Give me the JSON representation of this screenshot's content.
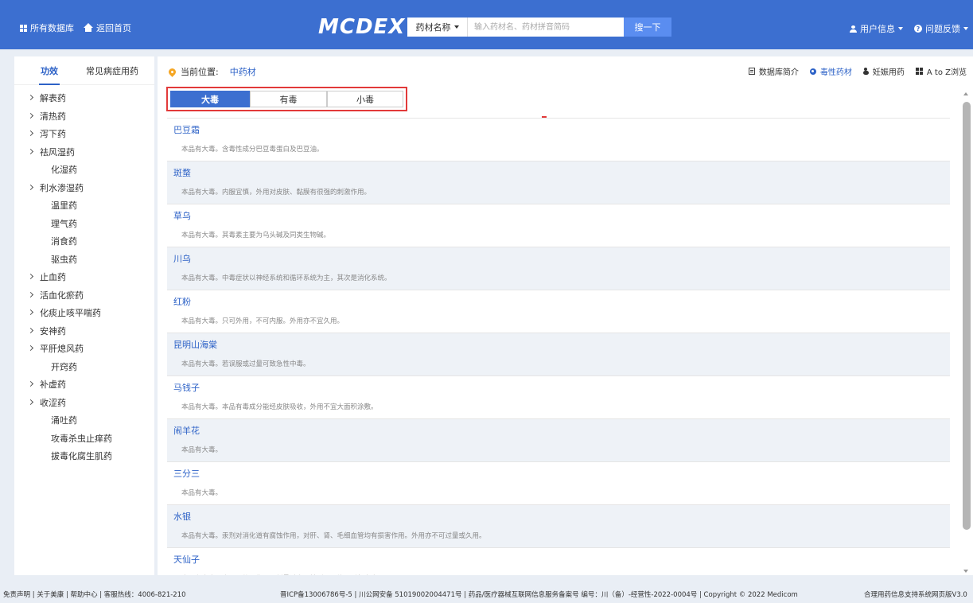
{
  "header": {
    "all_databases": "所有数据库",
    "back_home": "返回首页",
    "logo": "MCDEX",
    "search_type": "药材名称",
    "search_placeholder": "输入药材名、药材拼音简码",
    "search_button": "搜一下",
    "user_info": "用户信息",
    "feedback": "问题反馈"
  },
  "sidebar": {
    "tabs": [
      "功效",
      "常见病症用药"
    ],
    "items": [
      {
        "label": "解表药",
        "expandable": true
      },
      {
        "label": "清热药",
        "expandable": true
      },
      {
        "label": "泻下药",
        "expandable": true
      },
      {
        "label": "祛风湿药",
        "expandable": true
      },
      {
        "label": "化湿药",
        "expandable": false
      },
      {
        "label": "利水渗湿药",
        "expandable": true
      },
      {
        "label": "温里药",
        "expandable": false
      },
      {
        "label": "理气药",
        "expandable": false
      },
      {
        "label": "消食药",
        "expandable": false
      },
      {
        "label": "驱虫药",
        "expandable": false
      },
      {
        "label": "止血药",
        "expandable": true
      },
      {
        "label": "活血化瘀药",
        "expandable": true
      },
      {
        "label": "化痰止咳平喘药",
        "expandable": true
      },
      {
        "label": "安神药",
        "expandable": true
      },
      {
        "label": "平肝熄风药",
        "expandable": true
      },
      {
        "label": "开窍药",
        "expandable": false
      },
      {
        "label": "补虚药",
        "expandable": true
      },
      {
        "label": "收涩药",
        "expandable": true
      },
      {
        "label": "涌吐药",
        "expandable": false
      },
      {
        "label": "攻毒杀虫止痒药",
        "expandable": false
      },
      {
        "label": "拔毒化腐生肌药",
        "expandable": false
      }
    ]
  },
  "main": {
    "breadcrumb_label": "当前位置:",
    "breadcrumb_value": "中药材",
    "links": {
      "intro": "数据库简介",
      "toxic": "毒性药材",
      "pregnancy": "妊娠用药",
      "az": "A to Z浏览"
    },
    "tabs": [
      "大毒",
      "有毒",
      "小毒"
    ],
    "active_tab": 0,
    "rows": [
      {
        "name": "巴豆霜",
        "desc": "本品有大毒。含毒性成分巴豆毒蛋白及巴豆油。"
      },
      {
        "name": "斑蝥",
        "desc": "本品有大毒。内服宜慎，外用对皮肤、黏膜有很强的刺激作用。"
      },
      {
        "name": "草乌",
        "desc": "本品有大毒。其毒素主要为乌头碱及同类生物碱。"
      },
      {
        "name": "川乌",
        "desc": "本品有大毒。中毒症状以神经系统和循环系统为主，其次是消化系统。"
      },
      {
        "name": "红粉",
        "desc": "本品有大毒。只可外用，不可内服。外用亦不宜久用。"
      },
      {
        "name": "昆明山海棠",
        "desc": "本品有大毒。若误服或过量可致急性中毒。"
      },
      {
        "name": "马钱子",
        "desc": "本品有大毒。本品有毒成分能经皮肤吸收，外用不宜大面积涂敷。"
      },
      {
        "name": "闹羊花",
        "desc": "本品有大毒。"
      },
      {
        "name": "三分三",
        "desc": "本品有大毒。"
      },
      {
        "name": "水银",
        "desc": "本品有大毒。汞剂对消化道有腐蚀作用，对肝、肾、毛细血管均有损害作用。外用亦不可过量或久用。"
      },
      {
        "name": "天仙子",
        "desc": "本品有大毒。内服天仙子生品，剂量过大，特别服用均可引起中毒。"
      }
    ]
  },
  "footer": {
    "left": "免责声明 | 关于美康 | 帮助中心 | 客服热线：4006-821-210",
    "center": "晋ICP备13006786号-5 | 川公网安备 51019002004471号 | 药品/医疗器械互联网信息服务备案号 编号：川（备）-经营性-2022-0004号 | Copyright © 2022 Medicom",
    "right": "合理用药信息支持系统网页版V3.0"
  },
  "colors": {
    "header_bg": "#3c6fd0",
    "accent": "#2d62c7",
    "highlight_border": "#e23a3a"
  }
}
